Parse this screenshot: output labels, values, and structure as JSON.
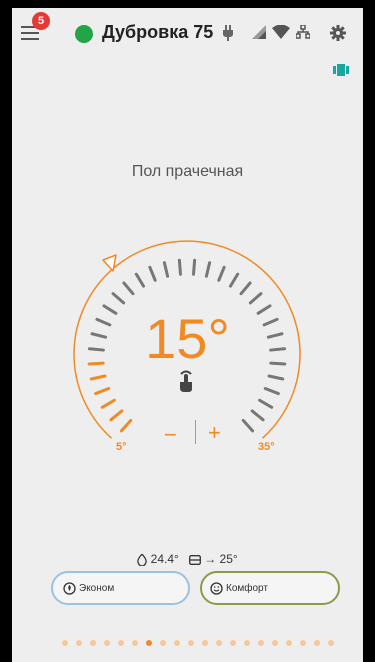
{
  "header": {
    "title": "Дубровка 75",
    "notification_count": "5",
    "status_color": "#21a546"
  },
  "room": {
    "name": "Пол прачечная"
  },
  "thermostat": {
    "temperature": "15°",
    "min_label": "5°",
    "max_label": "35°",
    "minus_label": "−",
    "plus_label": "+",
    "accent_color": "#f08a24"
  },
  "info": {
    "humidity_or_floor": "24.4°",
    "target": "→ 25°"
  },
  "modes": {
    "econ_label": "Эконом",
    "comfort_label": "Комфорт"
  },
  "pager": {
    "total": 20,
    "active_index": 6
  }
}
